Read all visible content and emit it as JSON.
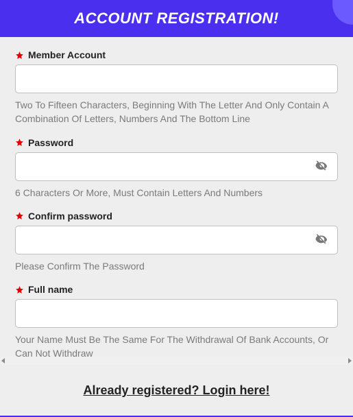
{
  "header": {
    "title": "ACCOUNT REGISTRATION!"
  },
  "fields": {
    "member": {
      "label": "Member Account",
      "value": "",
      "hint": "Two To Fifteen Characters, Beginning With The Letter And Only Contain A Combination Of Letters, Numbers And The Bottom Line"
    },
    "password": {
      "label": "Password",
      "value": "",
      "hint": "6 Characters Or More, Must Contain Letters And Numbers"
    },
    "confirm": {
      "label": "Confirm password",
      "value": "",
      "hint": "Please Confirm The Password"
    },
    "fullname": {
      "label": "Full name",
      "value": "",
      "hint": "Your Name Must Be The Same For The Withdrawal Of Bank Accounts, Or Can Not Withdraw"
    }
  },
  "footer": {
    "login_text": "Already registered? Login here!"
  },
  "colors": {
    "primary": "#4a2fef",
    "required_star": "#e40000"
  }
}
